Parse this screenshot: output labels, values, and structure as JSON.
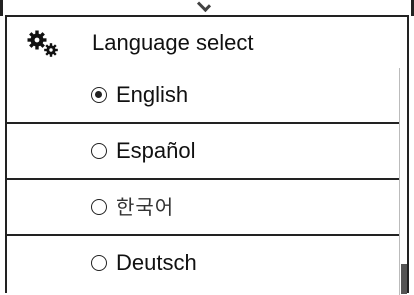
{
  "header": {
    "title": "Language select",
    "icon": "gears-icon"
  },
  "options": [
    {
      "label": "English",
      "selected": true
    },
    {
      "label": "Español",
      "selected": false
    },
    {
      "label": "한국어",
      "selected": false
    },
    {
      "label": "Deutsch",
      "selected": false
    }
  ],
  "colors": {
    "border": "#222222",
    "text": "#111111",
    "background": "#ffffff"
  }
}
